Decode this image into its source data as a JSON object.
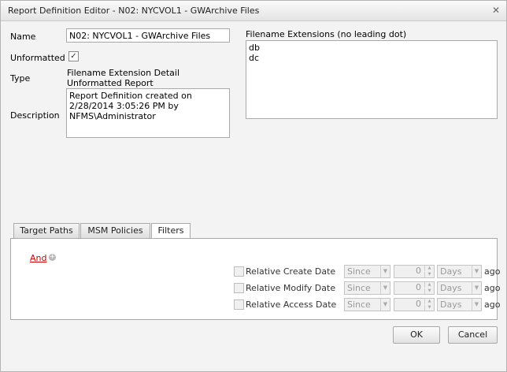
{
  "window": {
    "title": "Report Definition Editor - N02: NYCVOL1 - GWArchive Files",
    "close_glyph": "✕"
  },
  "form": {
    "name_label": "Name",
    "name_value": "N02: NYCVOL1 - GWArchive Files",
    "unformatted_label": "Unformatted",
    "unformatted_checked": true,
    "type_label": "Type",
    "type_value": "Filename Extension Detail Unformatted Report",
    "description_label": "Description",
    "description_value": "Report Definition created on 2/28/2014 3:05:26 PM by NFMS\\Administrator",
    "extensions_label": "Filename Extensions (no leading dot)",
    "extensions_value": "db\ndc"
  },
  "tabs": [
    {
      "label": "Target Paths",
      "active": false
    },
    {
      "label": "MSM Policies",
      "active": false
    },
    {
      "label": "Filters",
      "active": true
    }
  ],
  "filters": {
    "operator_label": "And",
    "add_icon": "plus-circle-icon",
    "rows": [
      {
        "label": "Relative Create Date",
        "mode": "Since",
        "amount": "0",
        "unit": "Days",
        "suffix": "ago"
      },
      {
        "label": "Relative Modify Date",
        "mode": "Since",
        "amount": "0",
        "unit": "Days",
        "suffix": "ago"
      },
      {
        "label": "Relative Access Date",
        "mode": "Since",
        "amount": "0",
        "unit": "Days",
        "suffix": "ago"
      }
    ]
  },
  "buttons": {
    "ok_label": "OK",
    "cancel_label": "Cancel"
  },
  "colors": {
    "link": "#cc0000",
    "dialog_bg": "#f3f3f3"
  }
}
